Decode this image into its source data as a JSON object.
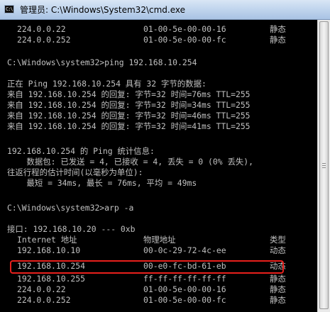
{
  "window": {
    "title": "管理员: C:\\Windows\\System32\\cmd.exe",
    "icon_label": "C:\\"
  },
  "colors": {
    "console_background": "#000000",
    "console_text": "#c0c0c0",
    "highlight_border": "#e8201c"
  },
  "icons": {
    "app_icon": "cmd-icon",
    "scrollbar_grip": "grip-icon"
  },
  "arp_top": [
    {
      "ip": "224.0.0.22",
      "mac": "01-00-5e-00-00-16",
      "type": "静态"
    },
    {
      "ip": "224.0.0.252",
      "mac": "01-00-5e-00-00-fc",
      "type": "静态"
    }
  ],
  "ping": {
    "command": "C:\\Windows\\system32>ping 192.168.10.254",
    "header": "正在 Ping 192.168.10.254 具有 32 字节的数据:",
    "replies": [
      "来自 192.168.10.254 的回复: 字节=32 时间=76ms TTL=255",
      "来自 192.168.10.254 的回复: 字节=32 时间=34ms TTL=255",
      "来自 192.168.10.254 的回复: 字节=32 时间=46ms TTL=255",
      "来自 192.168.10.254 的回复: 字节=32 时间=41ms TTL=255"
    ],
    "stats_title": "192.168.10.254 的 Ping 统计信息:",
    "stats_packets": "    数据包: 已发送 = 4, 已接收 = 4, 丢失 = 0 (0% 丢失),",
    "rtt_title": "往返行程的估计时间(以毫秒为单位):",
    "rtt_values": "    最短 = 34ms, 最长 = 76ms, 平均 = 49ms"
  },
  "arp": {
    "command": "C:\\Windows\\system32>arp -a",
    "interface": "接口: 192.168.10.20 --- 0xb",
    "headers": {
      "ip": "Internet 地址",
      "mac": "物理地址",
      "type": "类型"
    },
    "entries": [
      {
        "ip": "192.168.10.10",
        "mac": "00-0c-29-72-4c-ee",
        "type": "动态"
      },
      {
        "ip": "192.168.10.254",
        "mac": "00-e0-fc-bd-61-eb",
        "type": "动态"
      },
      {
        "ip": "192.168.10.255",
        "mac": "ff-ff-ff-ff-ff-ff",
        "type": "静态"
      },
      {
        "ip": "224.0.0.22",
        "mac": "01-00-5e-00-00-16",
        "type": "静态"
      },
      {
        "ip": "224.0.0.252",
        "mac": "01-00-5e-00-00-fc",
        "type": "静态"
      }
    ]
  }
}
